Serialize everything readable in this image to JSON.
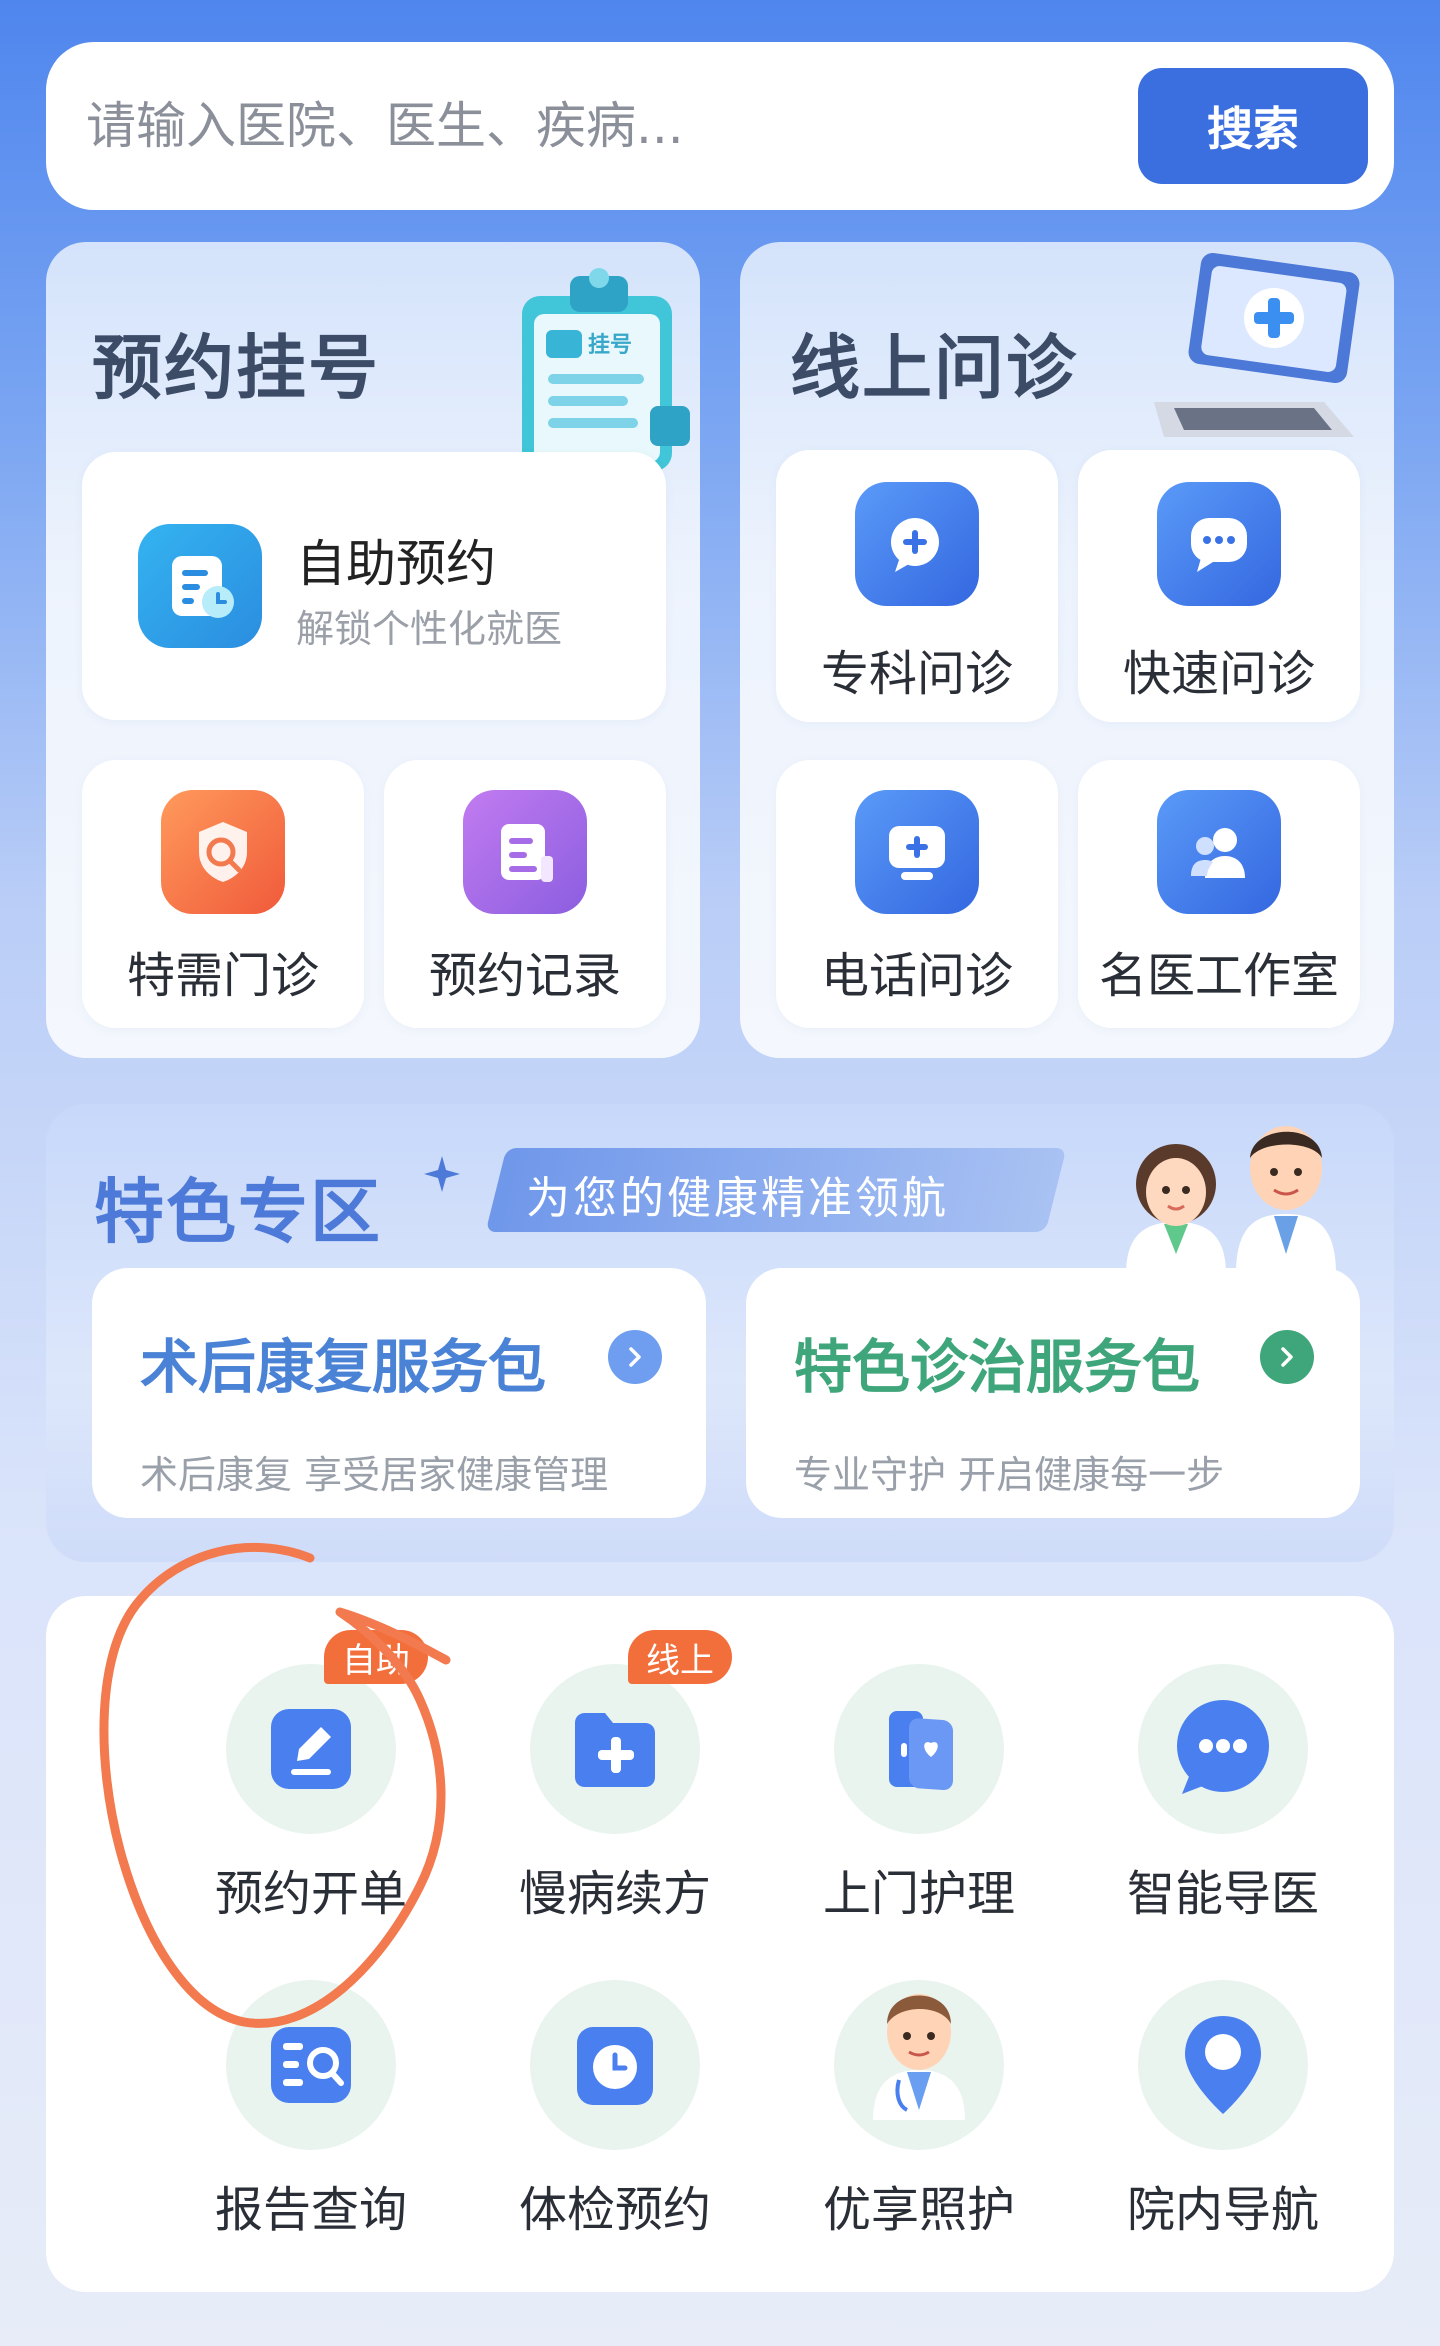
{
  "search": {
    "placeholder": "请输入医院、医生、疾病...",
    "button_label": "搜索"
  },
  "appointment": {
    "title": "预约挂号",
    "clipboard_badge": "挂号",
    "self_service": {
      "label": "自助预约",
      "sub": "解锁个性化就医"
    },
    "items": [
      {
        "label": "特需门诊",
        "icon": "shield-search-icon"
      },
      {
        "label": "预约记录",
        "icon": "record-icon"
      }
    ]
  },
  "online": {
    "title": "线上问诊",
    "items": [
      {
        "label": "专科问诊",
        "icon": "chat-plus-icon"
      },
      {
        "label": "快速问诊",
        "icon": "chat-dots-icon"
      },
      {
        "label": "电话问诊",
        "icon": "screen-plus-icon"
      },
      {
        "label": "名医工作室",
        "icon": "people-icon"
      }
    ]
  },
  "featured": {
    "title": "特色专区",
    "slogan": "为您的健康精准领航",
    "packages": [
      {
        "title": "术后康复服务包",
        "sub": "术后康复 享受居家健康管理",
        "color": "#4a82d6"
      },
      {
        "title": "特色诊治服务包",
        "sub": "专业守护  开启健康每一步",
        "color": "#3fa57a"
      }
    ]
  },
  "services": [
    {
      "label": "预约开单",
      "icon": "edit-icon",
      "badge": "自助"
    },
    {
      "label": "慢病续方",
      "icon": "folder-plus-icon",
      "badge": "线上"
    },
    {
      "label": "上门护理",
      "icon": "door-heart-icon",
      "badge": ""
    },
    {
      "label": "智能导医",
      "icon": "chat-bubble-icon",
      "badge": ""
    },
    {
      "label": "报告查询",
      "icon": "report-search-icon",
      "badge": ""
    },
    {
      "label": "体检预约",
      "icon": "clock-icon",
      "badge": ""
    },
    {
      "label": "优享照护",
      "icon": "doctor-icon",
      "badge": ""
    },
    {
      "label": "院内导航",
      "icon": "location-pin-icon",
      "badge": ""
    }
  ],
  "colors": {
    "primary": "#3b6fe0",
    "badge": "#f26f3c",
    "annotation": "#f27a4e"
  }
}
